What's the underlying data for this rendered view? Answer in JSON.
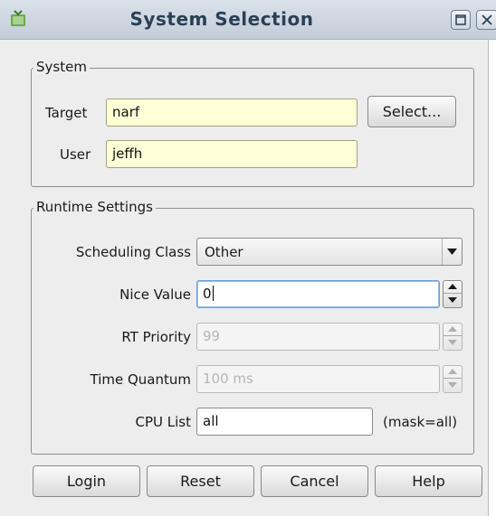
{
  "window": {
    "title": "System Selection"
  },
  "system": {
    "group_label": "System",
    "target_label": "Target",
    "target_value": "narf",
    "select_button": "Select...",
    "user_label": "User",
    "user_value": "jeffh"
  },
  "runtime": {
    "group_label": "Runtime Settings",
    "scheduling_class_label": "Scheduling Class",
    "scheduling_class_value": "Other",
    "nice_value_label": "Nice Value",
    "nice_value": "0",
    "rt_priority_label": "RT Priority",
    "rt_priority_value": "99",
    "time_quantum_label": "Time Quantum",
    "time_quantum_value": "100 ms",
    "cpu_list_label": "CPU List",
    "cpu_list_value": "all",
    "cpu_mask_text": "(mask=all)"
  },
  "buttons": {
    "login": "Login",
    "reset": "Reset",
    "cancel": "Cancel",
    "help": "Help"
  }
}
